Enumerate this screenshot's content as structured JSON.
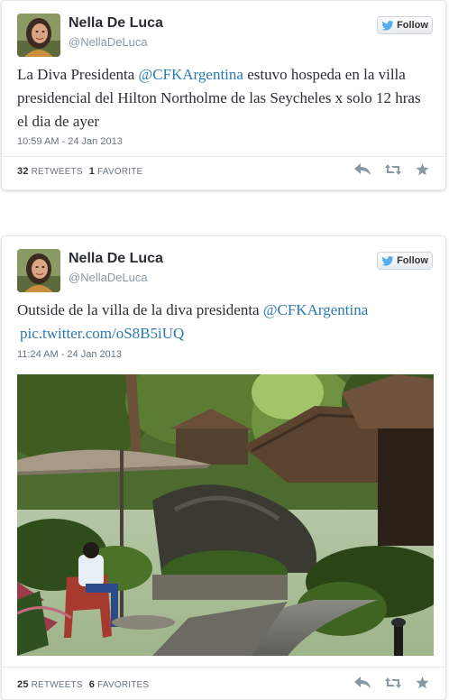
{
  "tweets": [
    {
      "name": "Nella De Luca",
      "handle": "@NellaDeLuca",
      "follow_label": "Follow",
      "text_before": "La Diva Presidenta ",
      "mention": "@CFKArgentina",
      "text_after": " estuvo hospeda en la villa presidencial del Hilton Northolme de las Seycheles x solo 12 hras el dia de ayer",
      "timestamp": "10:59 AM - 24 Jan 2013",
      "retweets_count": "32",
      "retweets_label": "RETWEETS",
      "favorites_count": "1",
      "favorites_label": "FAVORITE"
    },
    {
      "name": "Nella De Luca",
      "handle": "@NellaDeLuca",
      "follow_label": "Follow",
      "text_before": "Outside de la villa de la diva presidenta ",
      "mention": "@CFKArgentina",
      "link": "pic.twitter.com/oS8B5iUQ",
      "timestamp": "11:24 AM - 24 Jan 2013",
      "retweets_count": "25",
      "retweets_label": "RETWEETS",
      "favorites_count": "6",
      "favorites_label": "FAVORITES"
    }
  ],
  "icons": {
    "follow": "twitter-bird-icon",
    "reply": "reply-icon",
    "retweet": "retweet-icon",
    "favorite": "star-icon"
  },
  "colors": {
    "link": "#2a7ab0",
    "follow_bird": "#55acee",
    "meta_text": "#66757f",
    "action_icon": "#8899a6"
  }
}
